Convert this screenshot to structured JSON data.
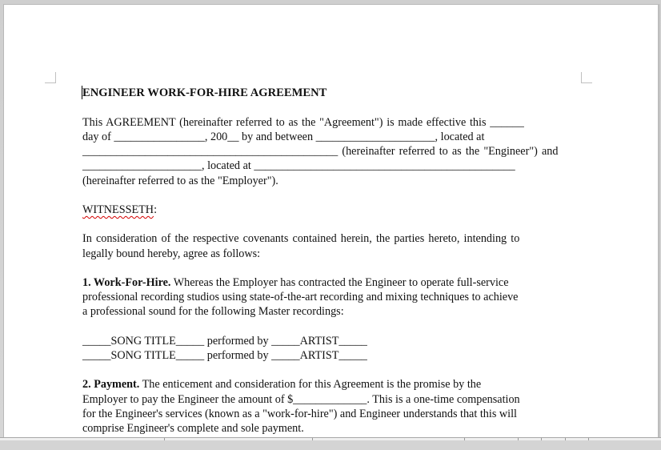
{
  "document": {
    "title": "ENGINEER WORK-FOR-HIRE AGREEMENT",
    "intro_lines": [
      "This AGREEMENT (hereinafter referred to as the \"Agreement\") is made effective this ______",
      "day of ________________, 200__ by and between _____________________, located at",
      "_____________________________________________ (hereinafter referred to as the \"Engineer\") and",
      "_____________________, located at ______________________________________________",
      "(hereinafter referred to as the \"Employer\")."
    ],
    "witnesseth": "WITNESSETH",
    "witnesseth_colon": ":",
    "consideration_lines": [
      "In consideration of the respective covenants contained herein, the parties hereto, intending to",
      "legally bound hereby, agree as follows:"
    ],
    "section1": {
      "heading": "1. Work-For-Hire.",
      "lines": [
        " Whereas the Employer has contracted the Engineer to operate full-service",
        "professional recording studios using state-of-the-art recording and mixing techniques to achieve",
        "a professional sound for the following Master recordings:"
      ]
    },
    "song_lines": [
      "_____SONG TITLE_____ performed by _____ARTIST_____",
      "_____SONG TITLE_____ performed by _____ARTIST_____"
    ],
    "section2": {
      "heading": "2. Payment.",
      "lines": [
        " The enticement and consideration for this Agreement is the promise by the",
        "Employer to pay the Engineer the amount of $_____________. This is a one-time compensation",
        "for the Engineer's services (known as a \"work-for-hire\") and Engineer understands that this will",
        "comprise Engineer's complete and sole payment."
      ]
    }
  },
  "colors": {
    "page": "#ffffff",
    "workspace": "#d4d4d4",
    "spell_underline": "#d40000",
    "text": "#111111"
  }
}
